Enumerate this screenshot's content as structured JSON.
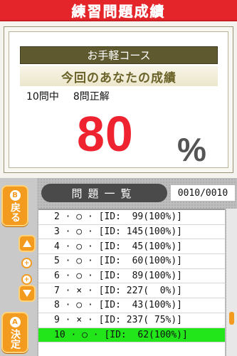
{
  "header": {
    "title": "練習問題成績"
  },
  "result": {
    "course": "お手軽コース",
    "heading": "今回のあなたの成績",
    "total_questions": "10問中",
    "correct_count": "8問正解",
    "score": "80",
    "percent_sign": "%"
  },
  "list_panel": {
    "header": "問題一覧",
    "page_indicator": "0010/0010",
    "rows": [
      "2 · ○ · [ID:  99(100%)]",
      "3 · ○ · [ID: 145(100%)]",
      "4 · ○ · [ID:  45(100%)]",
      "5 · ○ · [ID:  60(100%)]",
      "6 · ○ · [ID:  89(100%)]",
      "7 · × · [ID: 227(  0%)]",
      "8 · ○ · [ID:  43(100%)]",
      "9 · × · [ID: 237( 75%)]",
      "10 · ○ · [ID:  62(100%)]"
    ],
    "selected_index": 8
  },
  "side_buttons": {
    "back_badge": "B",
    "back_label": "戻る",
    "confirm_badge": "A",
    "confirm_label": "決定",
    "scroll_badge": "+"
  },
  "colors": {
    "title_bar": "#e4262b",
    "score": "#ef2230",
    "accent": "#f39b1f",
    "selected_row": "#22e61a"
  }
}
